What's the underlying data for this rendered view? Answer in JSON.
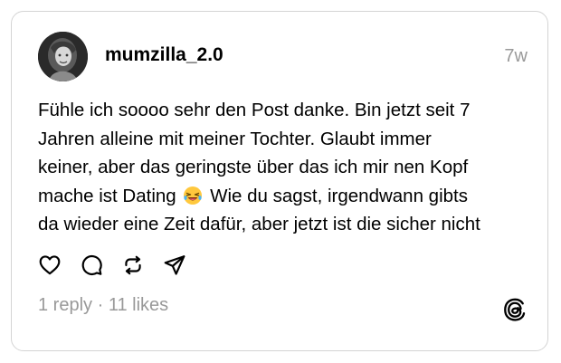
{
  "post": {
    "username": "mumzilla_2.0",
    "timestamp": "7w",
    "text_lines": [
      "Fühle ich soooo sehr den Post danke. Bin jetzt seit 7",
      "Jahren alleine mit meiner Tochter. Glaubt immer",
      "keiner, aber das geringste über das ich mir nen Kopf",
      "mache ist Dating",
      "Wie du sagst, irgendwann gibts",
      "da wieder eine Zeit dafür, aber jetzt ist die sicher nicht"
    ],
    "emoji": "face-with-tears-of-joy"
  },
  "actions": {
    "like_icon": "heart-icon",
    "comment_icon": "comment-icon",
    "repost_icon": "repost-icon",
    "share_icon": "share-icon"
  },
  "stats": {
    "replies": "1 reply",
    "separator": " · ",
    "likes": "11 likes"
  },
  "branding": {
    "logo": "threads-logo"
  },
  "colors": {
    "text": "#000000",
    "muted": "#999999",
    "border": "#d4d4d4",
    "background": "#ffffff"
  }
}
